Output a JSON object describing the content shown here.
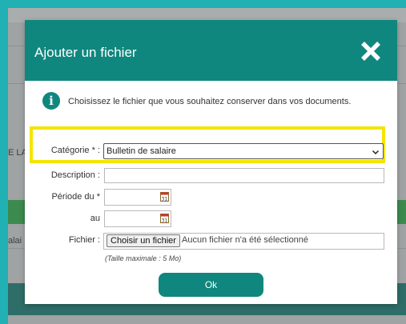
{
  "background": {
    "fragment_left_1": "E LA",
    "fragment_left_2": "alai"
  },
  "modal": {
    "title": "Ajouter un fichier",
    "close_icon": "close-icon",
    "info_icon": "info-icon",
    "info_glyph": "i",
    "info_text": "Choisissez le fichier que vous souhaitez conserver dans vos documents.",
    "highlight_color": "#f4e500",
    "header_color": "#0f877e"
  },
  "form": {
    "category_label": "Catégorie * :",
    "category_value": "Bulletin de salaire",
    "description_label": "Description :",
    "description_value": "",
    "period_from_label": "Période du *",
    "period_from_value": "",
    "period_to_label": "au",
    "period_to_value": "",
    "calendar_icon_label": "31",
    "file_label": "Fichier :",
    "file_button_label": "Choisir un fichier",
    "file_status": "Aucun fichier n'a été sélectionné",
    "max_size_note": "(Taille maximale : 5 Mo)",
    "submit_label": "Ok"
  }
}
